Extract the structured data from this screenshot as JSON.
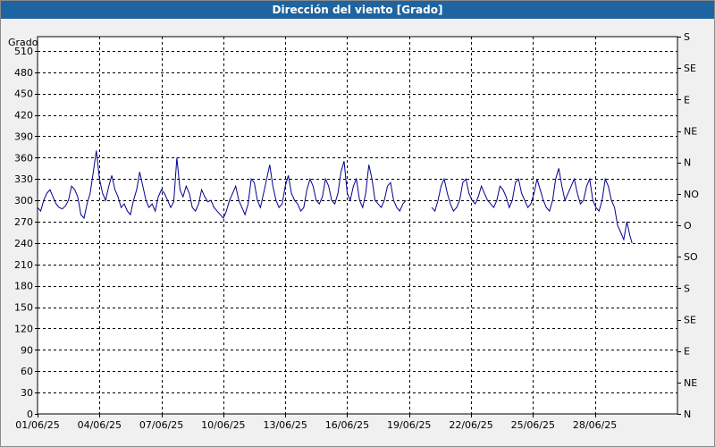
{
  "window": {
    "title": "Dirección del viento [Grado]"
  },
  "chart_data": {
    "type": "line",
    "title": "Dirección del viento [Grado]",
    "ylabel": "Grado",
    "xlabel": "",
    "ylim": [
      0,
      530
    ],
    "xlim": [
      0,
      31
    ],
    "grid": true,
    "x_tick_labels": [
      "01/06/25",
      "04/06/25",
      "07/06/25",
      "10/06/25",
      "13/06/25",
      "16/06/25",
      "19/06/25",
      "22/06/25",
      "25/06/25",
      "28/06/25"
    ],
    "x_tick_positions": [
      0,
      3,
      6,
      9,
      12,
      15,
      18,
      21,
      24,
      27
    ],
    "y_ticks": [
      0,
      30,
      60,
      90,
      120,
      150,
      180,
      210,
      240,
      270,
      300,
      330,
      360,
      390,
      420,
      450,
      480,
      510
    ],
    "right_axis_labels": [
      {
        "value": 0,
        "label": "N"
      },
      {
        "value": 45,
        "label": "NE"
      },
      {
        "value": 90,
        "label": "E"
      },
      {
        "value": 135,
        "label": "SE"
      },
      {
        "value": 180,
        "label": "S"
      },
      {
        "value": 225,
        "label": "SO"
      },
      {
        "value": 270,
        "label": "O"
      },
      {
        "value": 315,
        "label": "NO"
      },
      {
        "value": 360,
        "label": "N"
      },
      {
        "value": 405,
        "label": "NE"
      },
      {
        "value": 450,
        "label": "E"
      },
      {
        "value": 495,
        "label": "SE"
      },
      {
        "value": 540,
        "label": "S"
      }
    ],
    "series": [
      {
        "segments": [
          {
            "x": [
              0,
              0.15,
              0.3,
              0.45,
              0.6,
              0.75,
              0.9,
              1.05,
              1.2,
              1.35,
              1.5,
              1.65,
              1.8,
              1.95,
              2.1,
              2.25,
              2.4,
              2.55,
              2.7,
              2.85,
              3.0,
              3.15,
              3.3,
              3.45,
              3.6,
              3.75,
              3.9,
              4.05,
              4.2,
              4.35,
              4.5,
              4.65,
              4.8,
              4.95,
              5.1,
              5.25,
              5.4,
              5.55,
              5.7,
              5.85,
              6.0,
              6.15,
              6.3,
              6.45,
              6.6,
              6.75,
              6.9,
              7.05,
              7.2,
              7.35,
              7.5,
              7.65,
              7.8,
              7.95,
              8.1,
              8.25,
              8.4,
              8.55,
              8.7,
              8.85,
              9.0,
              9.15,
              9.3,
              9.45,
              9.6,
              9.75,
              9.9,
              10.05,
              10.2,
              10.35,
              10.5,
              10.65,
              10.8,
              10.95,
              11.1,
              11.25,
              11.4,
              11.55,
              11.7,
              11.85,
              12.0,
              12.15,
              12.3,
              12.45,
              12.6,
              12.75,
              12.9,
              13.05,
              13.2,
              13.35,
              13.5,
              13.65,
              13.8,
              13.95,
              14.1,
              14.25,
              14.4,
              14.55,
              14.7,
              14.85,
              15.0,
              15.15,
              15.3,
              15.45,
              15.6,
              15.75,
              15.9,
              16.05,
              16.2,
              16.35,
              16.5,
              16.65,
              16.8,
              16.95,
              17.1,
              17.25,
              17.4,
              17.55,
              17.7,
              17.85,
              18.0,
              18.15
            ],
            "y": [
              290,
              285,
              300,
              310,
              315,
              305,
              295,
              290,
              288,
              292,
              300,
              320,
              315,
              305,
              280,
              275,
              295,
              310,
              340,
              370,
              330,
              310,
              300,
              320,
              335,
              315,
              305,
              290,
              295,
              285,
              280,
              300,
              315,
              340,
              320,
              300,
              290,
              295,
              285,
              305,
              315,
              310,
              300,
              290,
              298,
              360,
              315,
              305,
              320,
              310,
              290,
              285,
              295,
              315,
              305,
              298,
              300,
              290,
              285,
              280,
              275,
              285,
              300,
              310,
              320,
              300,
              290,
              280,
              295,
              330,
              325,
              300,
              290,
              310,
              330,
              350,
              320,
              300,
              290,
              295,
              320,
              335,
              310,
              300,
              295,
              285,
              290,
              315,
              330,
              320,
              300,
              295,
              305,
              330,
              320,
              300,
              295,
              310,
              340,
              355,
              310,
              300,
              320,
              330,
              300,
              290,
              310,
              350,
              330,
              300,
              295,
              290,
              300,
              320,
              325,
              300,
              290,
              285,
              295,
              300
            ]
          },
          {
            "x": [
              19.1,
              19.25,
              19.4,
              19.55,
              19.7,
              19.85,
              20.0,
              20.15,
              20.3,
              20.45,
              20.6,
              20.75,
              20.9,
              21.05,
              21.2,
              21.35,
              21.5,
              21.65,
              21.8,
              21.95,
              22.1,
              22.25,
              22.4,
              22.55,
              22.7,
              22.85,
              23.0,
              23.15,
              23.3,
              23.45,
              23.6,
              23.75,
              23.9,
              24.05,
              24.2,
              24.35,
              24.5,
              24.65,
              24.8,
              24.95,
              25.1,
              25.25,
              25.4,
              25.55,
              25.7,
              25.85,
              26.0,
              26.15,
              26.3,
              26.45,
              26.6,
              26.75,
              26.9,
              27.05,
              27.2,
              27.35,
              27.5,
              27.65,
              27.8,
              27.95,
              28.1,
              28.25,
              28.4,
              28.55,
              28.7,
              28.8
            ],
            "y": [
              290,
              285,
              300,
              320,
              330,
              310,
              295,
              285,
              290,
              300,
              325,
              330,
              310,
              300,
              295,
              305,
              320,
              310,
              300,
              295,
              290,
              300,
              320,
              315,
              305,
              290,
              300,
              325,
              330,
              310,
              300,
              290,
              295,
              310,
              330,
              315,
              300,
              290,
              285,
              300,
              330,
              345,
              320,
              300,
              310,
              320,
              330,
              310,
              295,
              300,
              320,
              330,
              300,
              290,
              285,
              300,
              330,
              320,
              300,
              290,
              265,
              255,
              245,
              270,
              250,
              240
            ]
          }
        ]
      }
    ]
  }
}
